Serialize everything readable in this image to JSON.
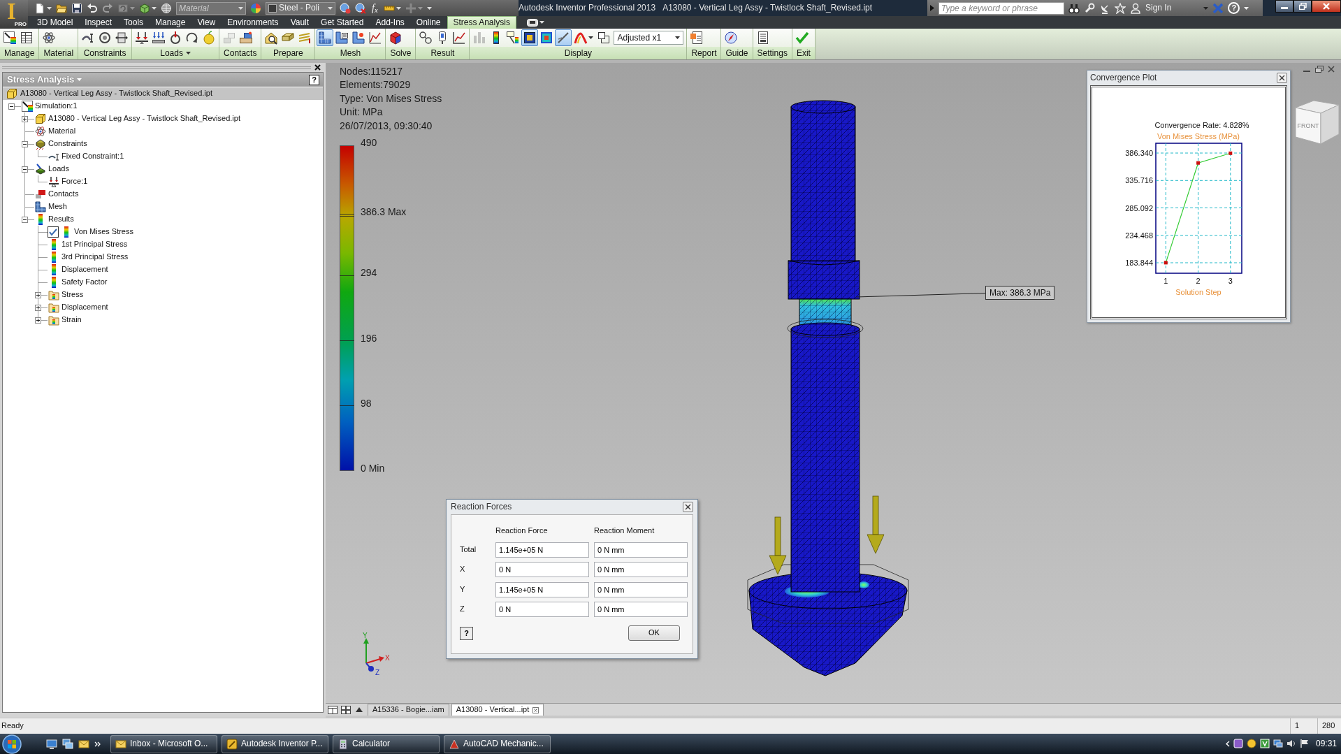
{
  "app_button": {
    "logo": "I",
    "edition": "PRO"
  },
  "quick_access": [
    {
      "kind": "new",
      "disabled": false
    },
    {
      "kind": "open",
      "disabled": false
    },
    {
      "kind": "save",
      "disabled": false
    },
    {
      "kind": "undo",
      "disabled": false
    },
    {
      "kind": "redo",
      "disabled": true
    },
    {
      "kind": "update",
      "disabled": true
    },
    {
      "kind": "select",
      "disabled": false
    },
    {
      "kind": "globe",
      "disabled": false
    },
    {
      "kind": "material",
      "placeholder": "Material",
      "disabled": false
    },
    {
      "kind": "colorball",
      "disabled": false
    },
    {
      "kind": "appearance",
      "value": "Steel - Poli",
      "disabled": false
    },
    {
      "kind": "adjust",
      "disabled": false
    },
    {
      "kind": "clear",
      "disabled": false
    },
    {
      "kind": "formula",
      "label": "f$_{x}$",
      "disabled": false
    },
    {
      "kind": "measure",
      "disabled": false
    },
    {
      "kind": "plus",
      "disabled": true
    },
    {
      "kind": "customize",
      "disabled": false
    }
  ],
  "window": {
    "app": "Autodesk Inventor Professional 2013",
    "title": "A13080 - Vertical Leg Assy - Twistlock Shaft_Revised.ipt"
  },
  "help_bar": {
    "placeholder": "Type a keyword or phrase",
    "sign_in": "Sign In",
    "help": "?"
  },
  "menu_tabs": [
    {
      "label": "3D Model",
      "selected": false
    },
    {
      "label": "Inspect",
      "selected": false
    },
    {
      "label": "Tools",
      "selected": false
    },
    {
      "label": "Manage",
      "selected": false
    },
    {
      "label": "View",
      "selected": false
    },
    {
      "label": "Environments",
      "selected": false
    },
    {
      "label": "Vault",
      "selected": false
    },
    {
      "label": "Get Started",
      "selected": false
    },
    {
      "label": "Add-Ins",
      "selected": false
    },
    {
      "label": "Online",
      "selected": false
    },
    {
      "label": "Stress Analysis",
      "selected": true
    }
  ],
  "ribbon": [
    {
      "label": "Manage",
      "overflow": false,
      "tools": [
        {
          "kind": "simulation",
          "on": false,
          "disabled": false
        },
        {
          "kind": "table",
          "on": false,
          "disabled": false
        }
      ]
    },
    {
      "label": "Material",
      "overflow": false,
      "tools": [
        {
          "kind": "material",
          "on": false,
          "disabled": false
        }
      ]
    },
    {
      "label": "Constraints",
      "overflow": false,
      "tools": [
        {
          "kind": "fixed",
          "on": false,
          "disabled": false
        },
        {
          "kind": "pin",
          "on": false,
          "disabled": false
        },
        {
          "kind": "frictionless",
          "on": false,
          "disabled": false
        }
      ]
    },
    {
      "label": "Loads",
      "overflow": true,
      "tools": [
        {
          "kind": "force",
          "on": false,
          "disabled": false
        },
        {
          "kind": "pressure",
          "on": false,
          "disabled": false
        },
        {
          "kind": "bearing",
          "on": false,
          "disabled": false
        },
        {
          "kind": "moment",
          "on": false,
          "disabled": false
        },
        {
          "kind": "gravity",
          "on": false,
          "disabled": false
        }
      ]
    },
    {
      "label": "Contacts",
      "overflow": false,
      "tools": [
        {
          "kind": "automatic",
          "on": false,
          "disabled": true
        },
        {
          "kind": "manual",
          "on": false,
          "disabled": false
        }
      ]
    },
    {
      "label": "Prepare",
      "overflow": false,
      "tools": [
        {
          "kind": "region",
          "on": false,
          "disabled": false
        },
        {
          "kind": "plate",
          "on": false,
          "disabled": false
        },
        {
          "kind": "beam",
          "on": false,
          "disabled": false
        }
      ]
    },
    {
      "label": "Mesh",
      "overflow": false,
      "tools": [
        {
          "kind": "meshview",
          "on": true,
          "disabled": false
        },
        {
          "kind": "meshsettings",
          "on": false,
          "disabled": false
        },
        {
          "kind": "localmesh",
          "on": false,
          "disabled": false
        },
        {
          "kind": "convergence",
          "on": false,
          "disabled": false
        }
      ]
    },
    {
      "label": "Solve",
      "overflow": false,
      "tools": [
        {
          "kind": "solve",
          "on": false,
          "disabled": false
        }
      ]
    },
    {
      "label": "Result",
      "overflow": false,
      "tools": [
        {
          "kind": "animate",
          "on": false,
          "disabled": false
        },
        {
          "kind": "probe",
          "on": false,
          "disabled": false
        },
        {
          "kind": "graph",
          "on": false,
          "disabled": false
        }
      ]
    },
    {
      "label": "Display",
      "overflow": false,
      "tools": [
        {
          "kind": "barchart",
          "on": false,
          "disabled": true
        },
        {
          "kind": "colorbar",
          "on": false,
          "disabled": false
        },
        {
          "kind": "probelabel",
          "on": false,
          "disabled": false
        },
        {
          "kind": "shaded",
          "on": true,
          "disabled": false
        },
        {
          "kind": "contour",
          "on": false,
          "disabled": false
        },
        {
          "kind": "boundary",
          "on": true,
          "disabled": false
        },
        {
          "kind": "colorscale",
          "on": false,
          "disabled": false
        },
        {
          "kind": "deformation",
          "on": false,
          "disabled": false
        },
        {
          "kind": "scale",
          "value": "Adjusted x1",
          "on": false,
          "disabled": false
        }
      ]
    },
    {
      "label": "Report",
      "overflow": false,
      "tools": [
        {
          "kind": "report",
          "on": false,
          "disabled": false
        }
      ]
    },
    {
      "label": "Guide",
      "overflow": false,
      "tools": [
        {
          "kind": "guide",
          "on": false,
          "disabled": false
        }
      ]
    },
    {
      "label": "Settings",
      "overflow": false,
      "tools": [
        {
          "kind": "settings",
          "on": false,
          "disabled": false
        }
      ]
    },
    {
      "label": "Exit",
      "overflow": false,
      "tools": [
        {
          "kind": "exit",
          "on": false,
          "disabled": false
        }
      ]
    }
  ],
  "browser": {
    "title": "Stress Analysis",
    "help": "?",
    "root": {
      "kind": "part",
      "label": "A13080 - Vertical Leg Assy - Twistlock Shaft_Revised.ipt",
      "selected": true
    },
    "items": [
      {
        "kind": "simulation",
        "label": "Simulation:1",
        "expanded": true,
        "selected": false,
        "children": [
          {
            "kind": "part",
            "label": "A13080 - Vertical Leg Assy - Twistlock Shaft_Revised.ipt",
            "expanded": false,
            "selected": false
          },
          {
            "kind": "material",
            "label": "Material",
            "selected": false
          },
          {
            "kind": "constraints",
            "label": "Constraints",
            "expanded": true,
            "selected": false,
            "children": [
              {
                "kind": "fixed",
                "label": "Fixed Constraint:1",
                "selected": false
              }
            ]
          },
          {
            "kind": "loads",
            "label": "Loads",
            "expanded": true,
            "selected": false,
            "children": [
              {
                "kind": "force",
                "label": "Force:1",
                "selected": false
              }
            ]
          },
          {
            "kind": "contacts",
            "label": "Contacts",
            "selected": false
          },
          {
            "kind": "mesh",
            "label": "Mesh",
            "selected": false
          },
          {
            "kind": "results",
            "label": "Results",
            "expanded": true,
            "selected": false,
            "children": [
              {
                "kind": "result",
                "label": "Von Mises Stress",
                "active": true,
                "selected": false
              },
              {
                "kind": "result",
                "label": "1st Principal Stress",
                "active": false,
                "selected": false
              },
              {
                "kind": "result",
                "label": "3rd Principal Stress",
                "active": false,
                "selected": false
              },
              {
                "kind": "result",
                "label": "Displacement",
                "active": false,
                "selected": false
              },
              {
                "kind": "result",
                "label": "Safety Factor",
                "active": false,
                "selected": false
              },
              {
                "kind": "folder",
                "label": "Stress",
                "expanded": false,
                "active": false,
                "selected": false
              },
              {
                "kind": "folder",
                "label": "Displacement",
                "expanded": false,
                "active": false,
                "selected": false
              },
              {
                "kind": "folder",
                "label": "Strain",
                "expanded": false,
                "active": false,
                "selected": false
              }
            ]
          }
        ]
      }
    ]
  },
  "viewport": {
    "result_info": [
      "Nodes:115217",
      "Elements:79029",
      "Type: Von Mises Stress",
      "Unit: MPa",
      "26/07/2013, 09:30:40"
    ],
    "legend": [
      "490",
      "386.3 Max",
      "294",
      "196",
      "98",
      "0 Min"
    ],
    "max_label": "Max: 386.3 MPa",
    "view_cube": "FRONT",
    "axes": [
      "X",
      "Y",
      "Z"
    ],
    "convergence_plot": {
      "title": "Convergence Plot",
      "chart_data": {
        "type": "line",
        "title": "Convergence Rate: 4.828%",
        "xlabel": "Solution Step",
        "ylabel": "Von Mises Stress (MPa)",
        "x": [
          1,
          2,
          3
        ],
        "values": [
          184,
          368,
          386
        ],
        "xlim": [
          0.69,
          3.35
        ],
        "ylim": [
          164.5,
          404.4
        ],
        "xticks": [
          1,
          2,
          3
        ],
        "yticks": [
          {
            "value": 183.844,
            "label": "183.844"
          },
          {
            "value": 234.468,
            "label": "234.468"
          },
          {
            "value": 285.092,
            "label": "285.092"
          },
          {
            "value": 335.716,
            "label": "335.716"
          },
          {
            "value": 386.34,
            "label": "386.340"
          }
        ],
        "grid": true,
        "marker": "square"
      }
    },
    "reaction_forces": {
      "title": "Reaction Forces",
      "columns": [
        "Reaction Force",
        "Reaction Moment"
      ],
      "rows": [
        {
          "label": "Total",
          "values": [
            "1.145e+05 N",
            "0 N mm"
          ]
        },
        {
          "label": "X",
          "values": [
            "0 N",
            "0 N mm"
          ]
        },
        {
          "label": "Y",
          "values": [
            "1.145e+05 N",
            "0 N mm"
          ]
        },
        {
          "label": "Z",
          "values": [
            "0 N",
            "0 N mm"
          ]
        }
      ],
      "help": "?",
      "ok": "OK"
    }
  },
  "document_tabs": [
    {
      "label": "A15336 - Bogie...iam",
      "selected": false
    },
    {
      "label": "A13080 - Vertical...ipt",
      "selected": true
    }
  ],
  "status_bar": {
    "message": "Ready",
    "fields": [
      "1",
      "280"
    ]
  },
  "taskbar": {
    "buttons": [
      {
        "kind": "mail",
        "label": "Inbox - Microsoft O..."
      },
      {
        "kind": "inventor",
        "label": "Autodesk Inventor P..."
      },
      {
        "kind": "calculator",
        "label": "Calculator"
      },
      {
        "kind": "autocad",
        "label": "AutoCAD Mechanic..."
      }
    ],
    "clock": "09:31"
  }
}
